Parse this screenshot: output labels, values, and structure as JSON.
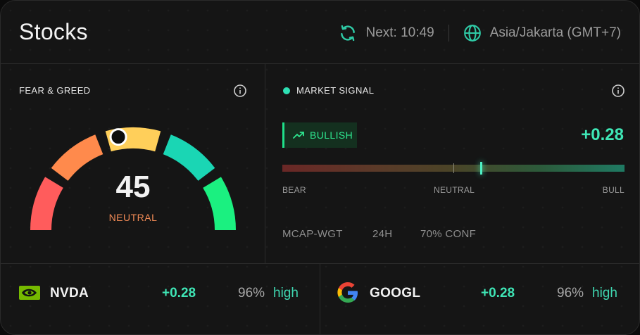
{
  "header": {
    "title": "Stocks",
    "next_label": "Next: 10:49",
    "timezone": "Asia/Jakarta (GMT+7)",
    "icons": [
      "refresh-icon",
      "globe-icon"
    ]
  },
  "fear_greed": {
    "label": "FEAR & GREED",
    "value": "45",
    "value_number": 45,
    "status": "NEUTRAL",
    "segment_colors": [
      "#ff5c5c",
      "#ff8a4c",
      "#ffcf5a",
      "#1ad6b4",
      "#1bf080"
    ]
  },
  "market_signal": {
    "label": "MARKET SIGNAL",
    "badge": "BULLISH",
    "delta": "+0.28",
    "bar_position": 0.58,
    "scale": {
      "bear": "BEAR",
      "neutral": "NEUTRAL",
      "bull": "BULL"
    },
    "meta": [
      "MCAP-WGT",
      "24H",
      "70% CONF"
    ]
  },
  "tickers": [
    {
      "symbol": "NVDA",
      "delta": "+0.28",
      "confidence": "96%",
      "level": "high",
      "logo": "nvidia-logo-icon"
    },
    {
      "symbol": "GOOGL",
      "delta": "+0.28",
      "confidence": "96%",
      "level": "high",
      "logo": "google-logo-icon"
    }
  ],
  "colors": {
    "accent": "#3fe6b6",
    "neutral": "#f08a56",
    "bull": "#2ee58f"
  }
}
